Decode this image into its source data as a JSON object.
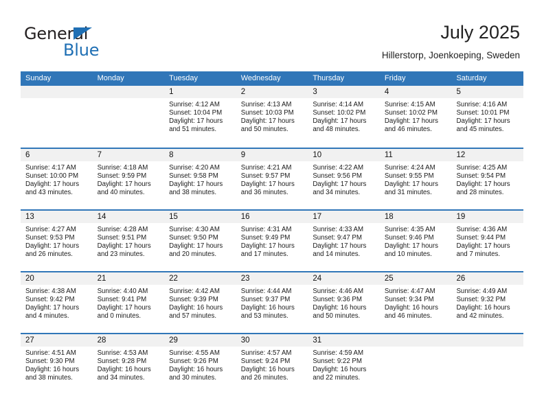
{
  "brand": {
    "name_part1": "General",
    "name_part2": "Blue",
    "accent_color": "#1f6fb4"
  },
  "header": {
    "title": "July 2025",
    "subtitle": "Hillerstorp, Joenkoeping, Sweden"
  },
  "calendar": {
    "header_bg": "#3076b8",
    "daynum_bg": "#f1f1f1",
    "weekday_names": [
      "Sunday",
      "Monday",
      "Tuesday",
      "Wednesday",
      "Thursday",
      "Friday",
      "Saturday"
    ],
    "weeks": [
      [
        {
          "day": "",
          "sunrise": "",
          "sunset": "",
          "daylight_line1": "",
          "daylight_line2": ""
        },
        {
          "day": "",
          "sunrise": "",
          "sunset": "",
          "daylight_line1": "",
          "daylight_line2": ""
        },
        {
          "day": "1",
          "sunrise": "Sunrise: 4:12 AM",
          "sunset": "Sunset: 10:04 PM",
          "daylight_line1": "Daylight: 17 hours",
          "daylight_line2": "and 51 minutes."
        },
        {
          "day": "2",
          "sunrise": "Sunrise: 4:13 AM",
          "sunset": "Sunset: 10:03 PM",
          "daylight_line1": "Daylight: 17 hours",
          "daylight_line2": "and 50 minutes."
        },
        {
          "day": "3",
          "sunrise": "Sunrise: 4:14 AM",
          "sunset": "Sunset: 10:02 PM",
          "daylight_line1": "Daylight: 17 hours",
          "daylight_line2": "and 48 minutes."
        },
        {
          "day": "4",
          "sunrise": "Sunrise: 4:15 AM",
          "sunset": "Sunset: 10:02 PM",
          "daylight_line1": "Daylight: 17 hours",
          "daylight_line2": "and 46 minutes."
        },
        {
          "day": "5",
          "sunrise": "Sunrise: 4:16 AM",
          "sunset": "Sunset: 10:01 PM",
          "daylight_line1": "Daylight: 17 hours",
          "daylight_line2": "and 45 minutes."
        }
      ],
      [
        {
          "day": "6",
          "sunrise": "Sunrise: 4:17 AM",
          "sunset": "Sunset: 10:00 PM",
          "daylight_line1": "Daylight: 17 hours",
          "daylight_line2": "and 43 minutes."
        },
        {
          "day": "7",
          "sunrise": "Sunrise: 4:18 AM",
          "sunset": "Sunset: 9:59 PM",
          "daylight_line1": "Daylight: 17 hours",
          "daylight_line2": "and 40 minutes."
        },
        {
          "day": "8",
          "sunrise": "Sunrise: 4:20 AM",
          "sunset": "Sunset: 9:58 PM",
          "daylight_line1": "Daylight: 17 hours",
          "daylight_line2": "and 38 minutes."
        },
        {
          "day": "9",
          "sunrise": "Sunrise: 4:21 AM",
          "sunset": "Sunset: 9:57 PM",
          "daylight_line1": "Daylight: 17 hours",
          "daylight_line2": "and 36 minutes."
        },
        {
          "day": "10",
          "sunrise": "Sunrise: 4:22 AM",
          "sunset": "Sunset: 9:56 PM",
          "daylight_line1": "Daylight: 17 hours",
          "daylight_line2": "and 34 minutes."
        },
        {
          "day": "11",
          "sunrise": "Sunrise: 4:24 AM",
          "sunset": "Sunset: 9:55 PM",
          "daylight_line1": "Daylight: 17 hours",
          "daylight_line2": "and 31 minutes."
        },
        {
          "day": "12",
          "sunrise": "Sunrise: 4:25 AM",
          "sunset": "Sunset: 9:54 PM",
          "daylight_line1": "Daylight: 17 hours",
          "daylight_line2": "and 28 minutes."
        }
      ],
      [
        {
          "day": "13",
          "sunrise": "Sunrise: 4:27 AM",
          "sunset": "Sunset: 9:53 PM",
          "daylight_line1": "Daylight: 17 hours",
          "daylight_line2": "and 26 minutes."
        },
        {
          "day": "14",
          "sunrise": "Sunrise: 4:28 AM",
          "sunset": "Sunset: 9:51 PM",
          "daylight_line1": "Daylight: 17 hours",
          "daylight_line2": "and 23 minutes."
        },
        {
          "day": "15",
          "sunrise": "Sunrise: 4:30 AM",
          "sunset": "Sunset: 9:50 PM",
          "daylight_line1": "Daylight: 17 hours",
          "daylight_line2": "and 20 minutes."
        },
        {
          "day": "16",
          "sunrise": "Sunrise: 4:31 AM",
          "sunset": "Sunset: 9:49 PM",
          "daylight_line1": "Daylight: 17 hours",
          "daylight_line2": "and 17 minutes."
        },
        {
          "day": "17",
          "sunrise": "Sunrise: 4:33 AM",
          "sunset": "Sunset: 9:47 PM",
          "daylight_line1": "Daylight: 17 hours",
          "daylight_line2": "and 14 minutes."
        },
        {
          "day": "18",
          "sunrise": "Sunrise: 4:35 AM",
          "sunset": "Sunset: 9:46 PM",
          "daylight_line1": "Daylight: 17 hours",
          "daylight_line2": "and 10 minutes."
        },
        {
          "day": "19",
          "sunrise": "Sunrise: 4:36 AM",
          "sunset": "Sunset: 9:44 PM",
          "daylight_line1": "Daylight: 17 hours",
          "daylight_line2": "and 7 minutes."
        }
      ],
      [
        {
          "day": "20",
          "sunrise": "Sunrise: 4:38 AM",
          "sunset": "Sunset: 9:42 PM",
          "daylight_line1": "Daylight: 17 hours",
          "daylight_line2": "and 4 minutes."
        },
        {
          "day": "21",
          "sunrise": "Sunrise: 4:40 AM",
          "sunset": "Sunset: 9:41 PM",
          "daylight_line1": "Daylight: 17 hours",
          "daylight_line2": "and 0 minutes."
        },
        {
          "day": "22",
          "sunrise": "Sunrise: 4:42 AM",
          "sunset": "Sunset: 9:39 PM",
          "daylight_line1": "Daylight: 16 hours",
          "daylight_line2": "and 57 minutes."
        },
        {
          "day": "23",
          "sunrise": "Sunrise: 4:44 AM",
          "sunset": "Sunset: 9:37 PM",
          "daylight_line1": "Daylight: 16 hours",
          "daylight_line2": "and 53 minutes."
        },
        {
          "day": "24",
          "sunrise": "Sunrise: 4:46 AM",
          "sunset": "Sunset: 9:36 PM",
          "daylight_line1": "Daylight: 16 hours",
          "daylight_line2": "and 50 minutes."
        },
        {
          "day": "25",
          "sunrise": "Sunrise: 4:47 AM",
          "sunset": "Sunset: 9:34 PM",
          "daylight_line1": "Daylight: 16 hours",
          "daylight_line2": "and 46 minutes."
        },
        {
          "day": "26",
          "sunrise": "Sunrise: 4:49 AM",
          "sunset": "Sunset: 9:32 PM",
          "daylight_line1": "Daylight: 16 hours",
          "daylight_line2": "and 42 minutes."
        }
      ],
      [
        {
          "day": "27",
          "sunrise": "Sunrise: 4:51 AM",
          "sunset": "Sunset: 9:30 PM",
          "daylight_line1": "Daylight: 16 hours",
          "daylight_line2": "and 38 minutes."
        },
        {
          "day": "28",
          "sunrise": "Sunrise: 4:53 AM",
          "sunset": "Sunset: 9:28 PM",
          "daylight_line1": "Daylight: 16 hours",
          "daylight_line2": "and 34 minutes."
        },
        {
          "day": "29",
          "sunrise": "Sunrise: 4:55 AM",
          "sunset": "Sunset: 9:26 PM",
          "daylight_line1": "Daylight: 16 hours",
          "daylight_line2": "and 30 minutes."
        },
        {
          "day": "30",
          "sunrise": "Sunrise: 4:57 AM",
          "sunset": "Sunset: 9:24 PM",
          "daylight_line1": "Daylight: 16 hours",
          "daylight_line2": "and 26 minutes."
        },
        {
          "day": "31",
          "sunrise": "Sunrise: 4:59 AM",
          "sunset": "Sunset: 9:22 PM",
          "daylight_line1": "Daylight: 16 hours",
          "daylight_line2": "and 22 minutes."
        },
        {
          "day": "",
          "sunrise": "",
          "sunset": "",
          "daylight_line1": "",
          "daylight_line2": ""
        },
        {
          "day": "",
          "sunrise": "",
          "sunset": "",
          "daylight_line1": "",
          "daylight_line2": ""
        }
      ]
    ]
  }
}
